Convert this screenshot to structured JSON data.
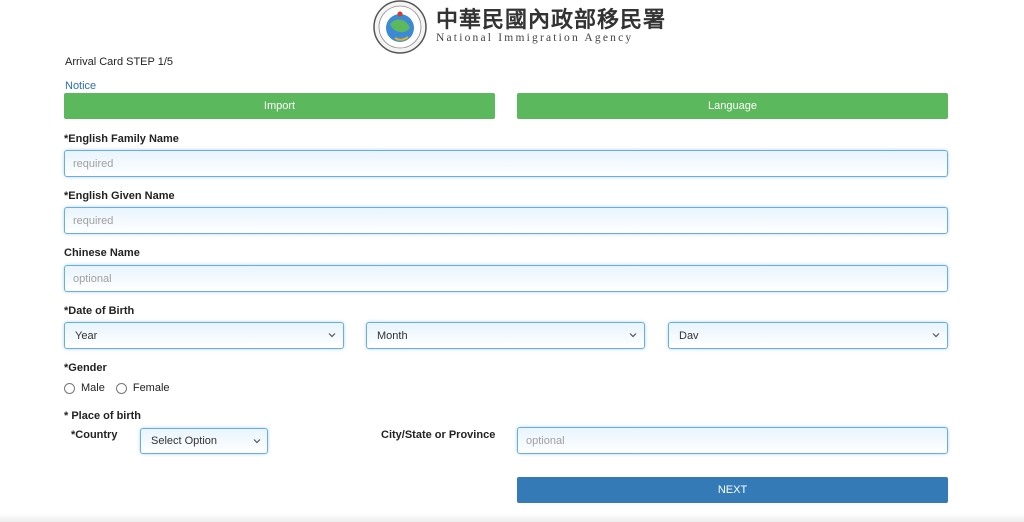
{
  "header": {
    "agency_chinese": "中華民國內政部移民署",
    "agency_english": "National Immigration Agency"
  },
  "step_title": "Arrival Card STEP 1/5",
  "notice_link": "Notice",
  "buttons": {
    "import": "Import",
    "language": "Language",
    "next": "NEXT"
  },
  "fields": {
    "family_name": {
      "label": "*English Family Name",
      "placeholder": "required",
      "value": ""
    },
    "given_name": {
      "label": "*English Given Name",
      "placeholder": "required",
      "value": ""
    },
    "chinese_name": {
      "label": "Chinese Name",
      "placeholder": "optional",
      "value": ""
    }
  },
  "date_of_birth": {
    "label": "*Date of Birth",
    "year": "Year",
    "month": "Month",
    "day": "Dav"
  },
  "gender": {
    "label": "*Gender",
    "options": [
      "Male",
      "Female"
    ]
  },
  "place_of_birth": {
    "label": "* Place of birth",
    "country_label": "*Country",
    "country_selected": "Select Option",
    "city_label": "City/State or Province",
    "city_placeholder": "optional"
  },
  "colors": {
    "green_button": "#5cb85c",
    "next_button": "#337ab7",
    "link": "#2a6fb5",
    "input_border": "#6aaee0"
  },
  "icons": [
    "agency-logo",
    "chevron-down-icon"
  ]
}
